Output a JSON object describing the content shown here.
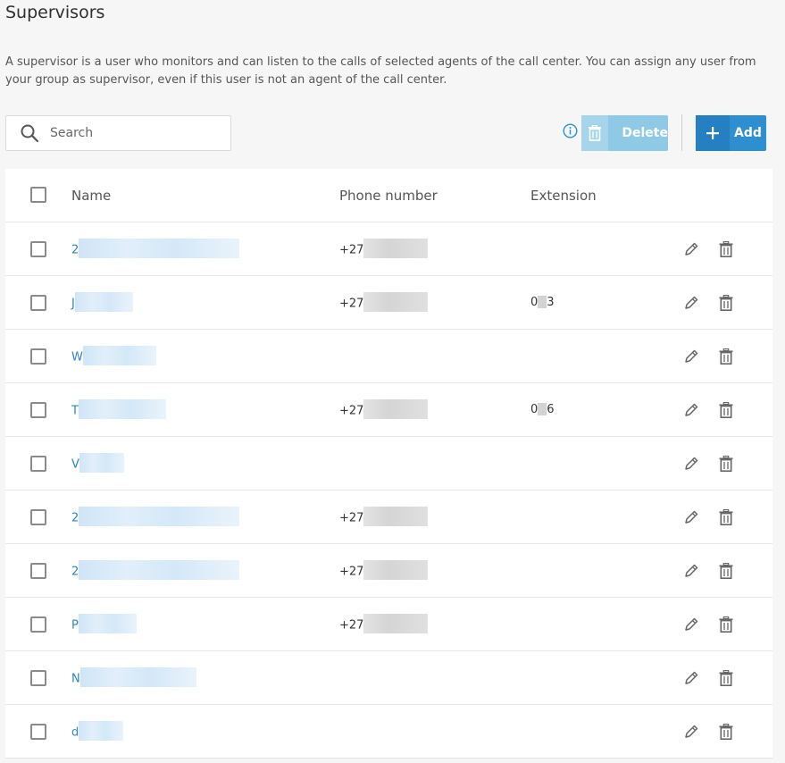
{
  "page": {
    "title": "Supervisors",
    "description": "A supervisor is a user who monitors and can listen to the calls of selected agents of the call center. You can assign any user from your group as supervisor, even if this user is not an agent of the call center."
  },
  "toolbar": {
    "search_placeholder": "Search",
    "delete_label": "Delete",
    "add_label": "Add"
  },
  "table": {
    "columns": {
      "name": "Name",
      "phone": "Phone number",
      "extension": "Extension"
    },
    "rows": [
      {
        "name": "2",
        "phone": "+27",
        "extension": ""
      },
      {
        "name": "J",
        "phone": "+27",
        "extension": "0 3"
      },
      {
        "name": "W",
        "phone": "",
        "extension": ""
      },
      {
        "name": "T",
        "phone": "+27",
        "extension": "0 6"
      },
      {
        "name": "V",
        "phone": "",
        "extension": ""
      },
      {
        "name": "2",
        "phone": "+27",
        "extension": ""
      },
      {
        "name": "2",
        "phone": "+27",
        "extension": ""
      },
      {
        "name": "P",
        "phone": "+27",
        "extension": ""
      },
      {
        "name": "N",
        "phone": "",
        "extension": ""
      },
      {
        "name": "d",
        "phone": "",
        "extension": ""
      }
    ]
  },
  "icons": [
    "search-icon",
    "info-icon",
    "trash-icon",
    "plus-icon",
    "pencil-icon"
  ],
  "colors": {
    "accent": "#2d8fd0",
    "link": "#2b86c3",
    "delete_disabled": "#8ecae6"
  }
}
